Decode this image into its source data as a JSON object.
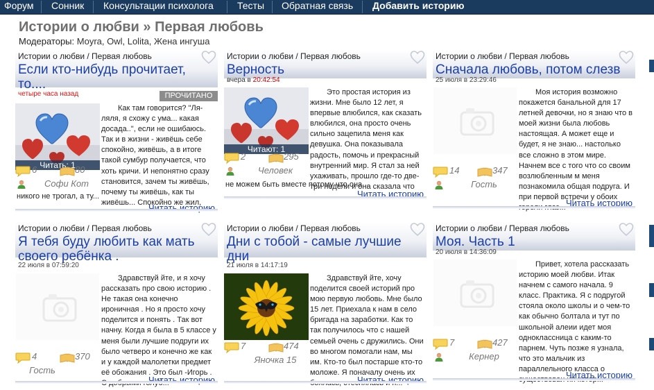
{
  "nav": {
    "items": [
      "Форум",
      "Сонник",
      "Консультации психолога",
      "Тесты",
      "Обратная связь",
      "Добавить историю"
    ]
  },
  "header": {
    "title": "Истории о любви » Первая любовь",
    "moderators_label": "Модераторы:",
    "moderators": "Moyra, Owl, Lolita, Жена ингуша"
  },
  "colors": {
    "nav_bg": "#1a3a5e",
    "title_link": "#1a3fa8",
    "badge": "#8c8c8c"
  },
  "stories": [
    {
      "category": "Истории о любви / Первая любовь",
      "title": "Если кто-нибудь прочитает, то....",
      "date": "четыре часа назад",
      "badge": "ПРОЧИТАНО",
      "image": "hearts",
      "reading": "Читать: 1",
      "comments": "6",
      "books": "80",
      "author": "Софи Кот",
      "excerpt_first": "Как там говорится? \"Ля-ляля, я схожу с ума... какая досада..\", если не ошибаюсь. Так и в жизни - живёшь себе спокойно, живёшь, а в итоге такой сумбур получается, что хоть кричи. И непонятно сразу становится, зачем ты живёшь, почему ты живёшь, как ты живёшь... Спокойно же жил,",
      "excerpt_tail": "никого не трогал, а ту...",
      "more": "Читать историю"
    },
    {
      "category": "Истории о любви / Первая любовь",
      "title": "Верность",
      "date_prefix": "вчера в ",
      "date_time": "20:42:54",
      "image": "hearts",
      "reading": "Читают: 1",
      "comments": "2",
      "books": "295",
      "author": "Человек",
      "excerpt_first": "Это простая история из жизни. Мне было 12 лет, я впервые влюбился, как сказать влюбился, она просто очень сильно зацепила меня как девушка. Она показывала радость, помочь и прекрасный внутренний мир. Я стал за ней ухаживать, прошло где-то две-три недели и она сказала что",
      "excerpt_tail": "не можем быть вместе потому что она ...",
      "more": "Читать историю"
    },
    {
      "category": "Истории о любви / Первая любовь",
      "title": "Сначала любовь, потом слезв",
      "date": "25 июля в 23:29:46",
      "image": "placeholder",
      "comments": "14",
      "books": "347",
      "author": "Гость",
      "excerpt_first": "Моя история возможно покажется банальной для 17 летней девочки, но я знаю что в моей жизни была любовь настоящая. А может еще и будет, я не знаю... настолько все сложно в этом мире. Начнем все с того что со своим возлюбленным м меня познакомила общая подруга. И при первой встречи у обоих горели глаз...",
      "more": "Читать историю"
    },
    {
      "category": "Истории о любви / Первая любовь",
      "title": "Я тебя буду любить как мать своего ребёнка .",
      "date": "22 июля в 07:59:20",
      "image": "placeholder",
      "comments": "4",
      "books": "370",
      "author": "Гость",
      "excerpt_first": "Здравствуй йте, и я хочу рассказать про свою историю . Не такая она конечно ироничная . Но я просто хочу поделится и понять . Так вот начну. Когда я была в 5 классе у меня были лучшие подруги их было четверо и конечно же как и у каждой малолетки предмет её обожания . Это был -Игорь . С добрыми голуб...",
      "more": "Читать историю"
    },
    {
      "category": "Истории о любви / Первая любовь",
      "title": "Дни с тобой - самые лучшие дни",
      "date": "21 июля в 14:17:19",
      "image": "flower",
      "comments": "7",
      "books": "474",
      "author": "Яночка 15",
      "excerpt_first": "Здравствуй йте, хочу поделится своей историй про мою первую любовь. Мне было 15 лет. Приехала к нам в село бригада на заработки. Как то так получилось что с нашей семьей очень с дружились. Они во многом помогали нам, мы им. Кто-то был постарше кто-то моложе. Я поначалу очень их боялась, стеснялась и п...",
      "more": "Читать историю"
    },
    {
      "category": "Истории о любви / Первая любовь",
      "title": "Моя. Часть 1",
      "date": "20 июля в 14:36:09",
      "image": "placeholder",
      "comments": "7",
      "books": "427",
      "author": "Кернер",
      "excerpt_first": "Привет, хотела рассказать историю моей любви. Итак начнем с самого начала. 9 класс. Практика. Я с подругой стояла около школы и о чем-то как обычно болтала и тут по школьной алеии идет моя одноклассница с каким-то парнем. Чуть позже я узнала, что это мальчик из параллельного класса о существован ии котор...",
      "more": "Читать историю"
    }
  ]
}
